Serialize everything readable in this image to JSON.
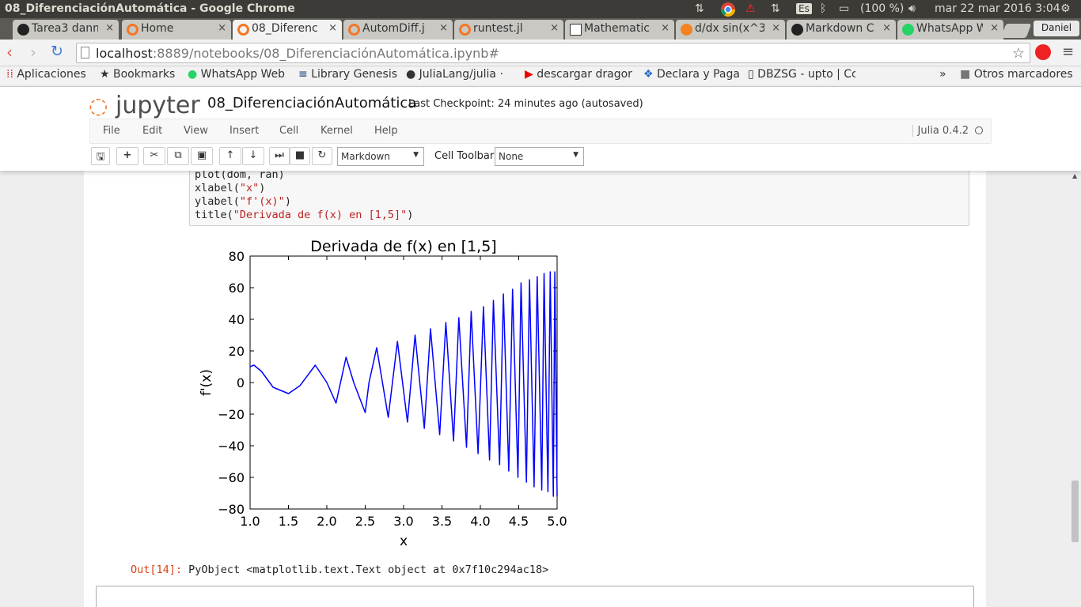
{
  "window": {
    "title": "08_DiferenciaciónAutomática - Google Chrome",
    "tray": {
      "battery": "(100 %)",
      "datetime": "mar 22 mar 2016  3:04",
      "lang": "Es"
    }
  },
  "tabs": [
    {
      "label": "Tarea3 danm",
      "icon": "github-icon"
    },
    {
      "label": "Home",
      "icon": "jupyter-icon"
    },
    {
      "label": "08_Diferenc",
      "icon": "jupyter-icon",
      "active": true
    },
    {
      "label": "AutomDiff.j",
      "icon": "jupyter-icon"
    },
    {
      "label": "runtest.jl",
      "icon": "jupyter-icon"
    },
    {
      "label": "Mathematic",
      "icon": "doc-icon"
    },
    {
      "label": "d/dx sin(x^3",
      "icon": "wolfram-icon"
    },
    {
      "label": "Markdown C",
      "icon": "github-icon"
    },
    {
      "label": "WhatsApp W",
      "icon": "whatsapp-icon"
    }
  ],
  "profile": "Daniel",
  "url": {
    "host": "localhost",
    "path": ":8889/notebooks/08_DiferenciaciónAutomática.ipynb#"
  },
  "bookmarks": [
    {
      "label": "Aplicaciones",
      "icon": "apps-icon"
    },
    {
      "label": "Bookmarks",
      "icon": "star-icon"
    },
    {
      "label": "WhatsApp Web",
      "icon": "whatsapp-icon"
    },
    {
      "label": "Library Genesis",
      "icon": "book-icon"
    },
    {
      "label": "JuliaLang/julia · ",
      "icon": "github-icon"
    },
    {
      "label": "descargar dragon",
      "icon": "youtube-icon"
    },
    {
      "label": "Declara y Paga",
      "icon": "dropbox-icon"
    },
    {
      "label": "DBZSG - upto | Cc",
      "icon": "page-icon"
    }
  ],
  "bookmarks_more": "»",
  "bookmarks_other": "Otros marcadores",
  "jupyter": {
    "logo": "jupyter",
    "notebook_name": "08_DiferenciaciónAutomática",
    "checkpoint": "Last Checkpoint: 24 minutes ago (autosaved)",
    "menu": [
      "File",
      "Edit",
      "View",
      "Insert",
      "Cell",
      "Kernel",
      "Help"
    ],
    "kernel": "Julia 0.4.2",
    "cell_type": "Markdown",
    "cell_toolbar_label": "Cell Toolbar:",
    "cell_toolbar_value": "None"
  },
  "code": {
    "line1": "plot(dom, ran)",
    "line2_fn": "xlabel(",
    "line2_str": "\"x\"",
    "line3_fn": "ylabel(",
    "line3_str": "\"f'(x)\"",
    "line4_fn": "title(",
    "line4_str": "\"Derivada de f(x) en [1,5]\"",
    "close": ")"
  },
  "output": {
    "prompt": "Out[14]:",
    "text": " PyObject <matplotlib.text.Text object at 0x7f10c294ac18>"
  },
  "chart_data": {
    "type": "line",
    "title": "Derivada de f(x) en [1,5]",
    "xlabel": "x",
    "ylabel": "f'(x)",
    "xlim": [
      1.0,
      5.0
    ],
    "ylim": [
      -80,
      80
    ],
    "xticks": [
      "1.0",
      "1.5",
      "2.0",
      "2.5",
      "3.0",
      "3.5",
      "4.0",
      "4.5",
      "5.0"
    ],
    "yticks": [
      "80",
      "60",
      "40",
      "20",
      "0",
      "−20",
      "−40",
      "−60",
      "−80"
    ],
    "grid": false,
    "color": "#0000ff",
    "series": [
      {
        "x": [
          1.0,
          1.05,
          1.15,
          1.3,
          1.5,
          1.65,
          1.85,
          2.0,
          2.12,
          2.25,
          2.35,
          2.5,
          2.55,
          2.65,
          2.8,
          2.92,
          3.05,
          3.15,
          3.27,
          3.35,
          3.47,
          3.55,
          3.65,
          3.72,
          3.82,
          3.88,
          3.97,
          4.04,
          4.12,
          4.17,
          4.25,
          4.3,
          4.37,
          4.42,
          4.49,
          4.53,
          4.6,
          4.64,
          4.7,
          4.74,
          4.8,
          4.83,
          4.88,
          4.91,
          4.95,
          4.97,
          5.0
        ],
        "y": [
          10,
          11,
          7,
          -3,
          -7,
          -2,
          11,
          0,
          -13,
          16,
          0,
          -19,
          0,
          22,
          -22,
          26,
          -25,
          30,
          -29,
          34,
          -33,
          38,
          -37,
          41,
          -41,
          45,
          -45,
          48,
          -49,
          52,
          -52,
          56,
          -56,
          59,
          -60,
          63,
          -63,
          65,
          -66,
          67,
          -68,
          69,
          -69,
          70,
          -72,
          70,
          -72
        ]
      }
    ]
  }
}
